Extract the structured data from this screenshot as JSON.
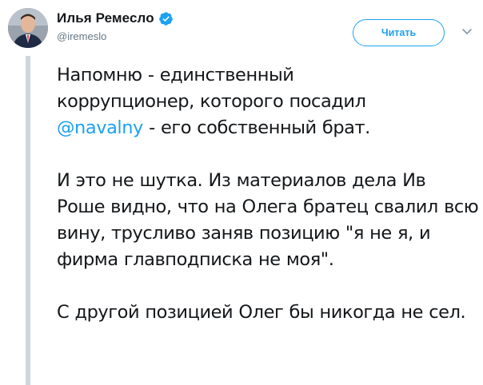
{
  "author": {
    "display_name": "Илья Ремесло",
    "handle": "@iremeslo",
    "verified": true
  },
  "actions": {
    "follow_label": "Читать",
    "caret_icon": "chevron-down-icon"
  },
  "tweet": {
    "paragraphs": [
      {
        "line1": "Напомню - единственный",
        "line2": "коррупционер, которого посадил",
        "mention": "@navalny",
        "after_mention": " - его собственный брат."
      },
      {
        "text": "И это не шутка. Из материалов дела Ив Роше видно, что на Олега братец свалил всю вину, трусливо заняв позицию \"я не я, и фирма главподписка не моя\"."
      },
      {
        "text": "С другой позицией Олег бы никогда не сел."
      }
    ]
  },
  "colors": {
    "accent": "#1da1f2",
    "text": "#14171a",
    "muted": "#657786",
    "thread_line": "#ccd6dd"
  }
}
